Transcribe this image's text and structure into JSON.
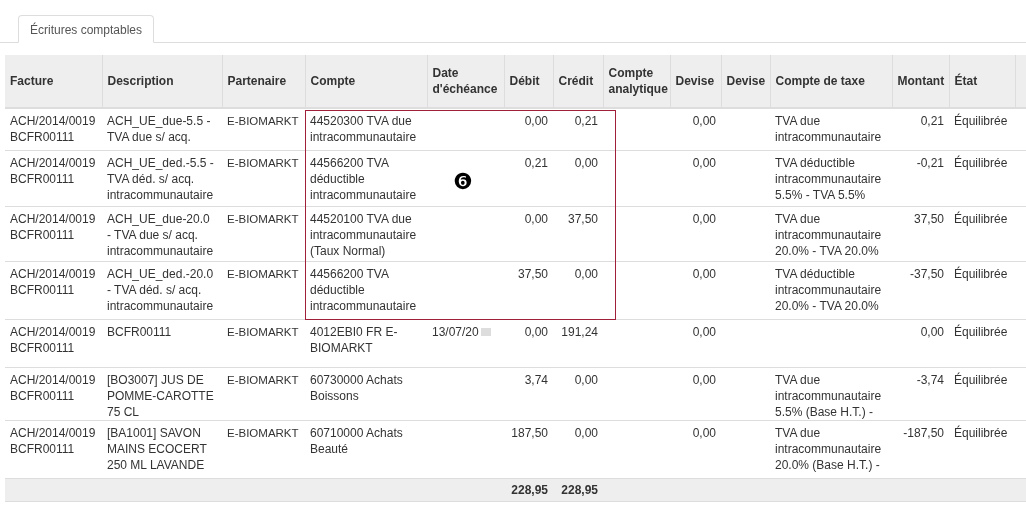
{
  "tabs": [
    {
      "label": "Écritures comptables",
      "selected": true
    }
  ],
  "table": {
    "columns": [
      "Facture",
      "Description",
      "Partenaire",
      "Compte",
      "Date d'échéance",
      "Débit",
      "Crédit",
      "Compte analytique",
      "Devise",
      "Devise",
      "Compte de taxe",
      "Montant",
      "État"
    ],
    "rows": [
      [
        "ACH/2014/0019 BCFR00111",
        "ACH_UE_due-5.5 - TVA due s/ acq.",
        "E-BIOMARKT",
        "44520300 TVA due intracommunautaire",
        null,
        "0,00",
        "0,21",
        null,
        "0,00",
        null,
        "TVA due intracommunautaire",
        "0,21",
        "Équilibrée"
      ],
      [
        "ACH/2014/0019 BCFR00111",
        "ACH_UE_ded.-5.5 - TVA déd. s/ acq. intracommunautaire",
        "E-BIOMARKT",
        "44566200 TVA déductible intracommunautaire",
        null,
        "0,21",
        "0,00",
        null,
        "0,00",
        null,
        "TVA déductible intracommunautaire 5.5% - TVA 5.5%",
        "-0,21",
        "Équilibrée"
      ],
      [
        "ACH/2014/0019 BCFR00111",
        "ACH_UE_due-20.0 - TVA due s/ acq. intracommunautaire",
        "E-BIOMARKT",
        "44520100 TVA due intracommunautaire (Taux Normal)",
        null,
        "0,00",
        "37,50",
        null,
        "0,00",
        null,
        "TVA due intracommunautaire 20.0% - TVA 20.0%",
        "37,50",
        "Équilibrée"
      ],
      [
        "ACH/2014/0019 BCFR00111",
        "ACH_UE_ded.-20.0 - TVA déd. s/ acq. intracommunautaire",
        "E-BIOMARKT",
        "44566200 TVA déductible intracommunautaire",
        null,
        "37,50",
        "0,00",
        null,
        "0,00",
        null,
        "TVA déductible intracommunautaire 20.0% - TVA 20.0%",
        "-37,50",
        "Équilibrée"
      ],
      [
        "ACH/2014/0019 BCFR00111",
        "BCFR00111",
        "E-BIOMARKT",
        "4012EBI0 FR E-BIOMARKT",
        "13/07/20",
        "0,00",
        "191,24",
        null,
        "0,00",
        null,
        null,
        "0,00",
        "Équilibrée"
      ],
      [
        "ACH/2014/0019 BCFR00111",
        "[BO3007] JUS DE POMME-CAROTTE 75 CL",
        "E-BIOMARKT",
        "60730000 Achats Boissons",
        null,
        "3,74",
        "0,00",
        null,
        "0,00",
        null,
        "TVA due intracommunautaire 5.5% (Base H.T.) -",
        "-3,74",
        "Équilibrée"
      ],
      [
        "ACH/2014/0019 BCFR00111",
        "[BA1001] SAVON MAINS ECOCERT 250 ML LAVANDE",
        "E-BIOMARKT",
        "60710000 Achats Beauté",
        null,
        "187,50",
        "0,00",
        null,
        "0,00",
        null,
        "TVA due intracommunautaire 20.0% (Base H.T.) -",
        "-187,50",
        "Équilibrée"
      ]
    ],
    "totals": {
      "debit": "228,95",
      "credit": "228,95"
    }
  },
  "callout": {
    "label": "❻"
  }
}
